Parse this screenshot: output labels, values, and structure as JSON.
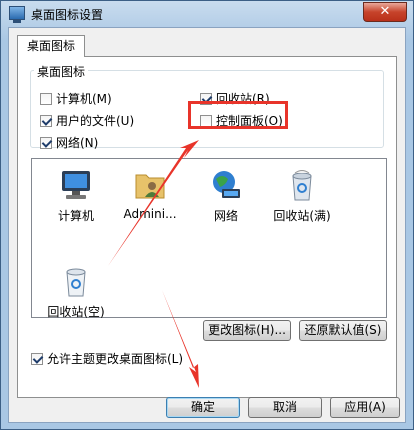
{
  "window": {
    "title": "桌面图标设置",
    "close_glyph": "✕"
  },
  "tab": {
    "label": "桌面图标"
  },
  "group": {
    "label": "桌面图标",
    "checkboxes": [
      {
        "label": "计算机(M)",
        "checked": false
      },
      {
        "label": "用户的文件(U)",
        "checked": true
      },
      {
        "label": "网络(N)",
        "checked": true
      },
      {
        "label": "回收站(R)",
        "checked": true
      },
      {
        "label": "控制面板(O)",
        "checked": false
      }
    ]
  },
  "icons": [
    {
      "label": "计算机",
      "icon": "computer-icon"
    },
    {
      "label": "Admini...",
      "icon": "user-folder-icon"
    },
    {
      "label": "网络",
      "icon": "network-icon"
    },
    {
      "label": "回收站(满)",
      "icon": "recycle-bin-full-icon"
    },
    {
      "label": "回收站(空)",
      "icon": "recycle-bin-empty-icon"
    }
  ],
  "buttons": {
    "change_icon": "更改图标(H)...",
    "restore_default": "还原默认值(S)",
    "ok": "确定",
    "cancel": "取消",
    "apply": "应用(A)"
  },
  "allow_themes": {
    "label": "允许主题更改桌面图标(L)",
    "checked": true
  },
  "colors": {
    "annotation_red": "#e8342a",
    "title_bar": "#a9c7e4"
  }
}
